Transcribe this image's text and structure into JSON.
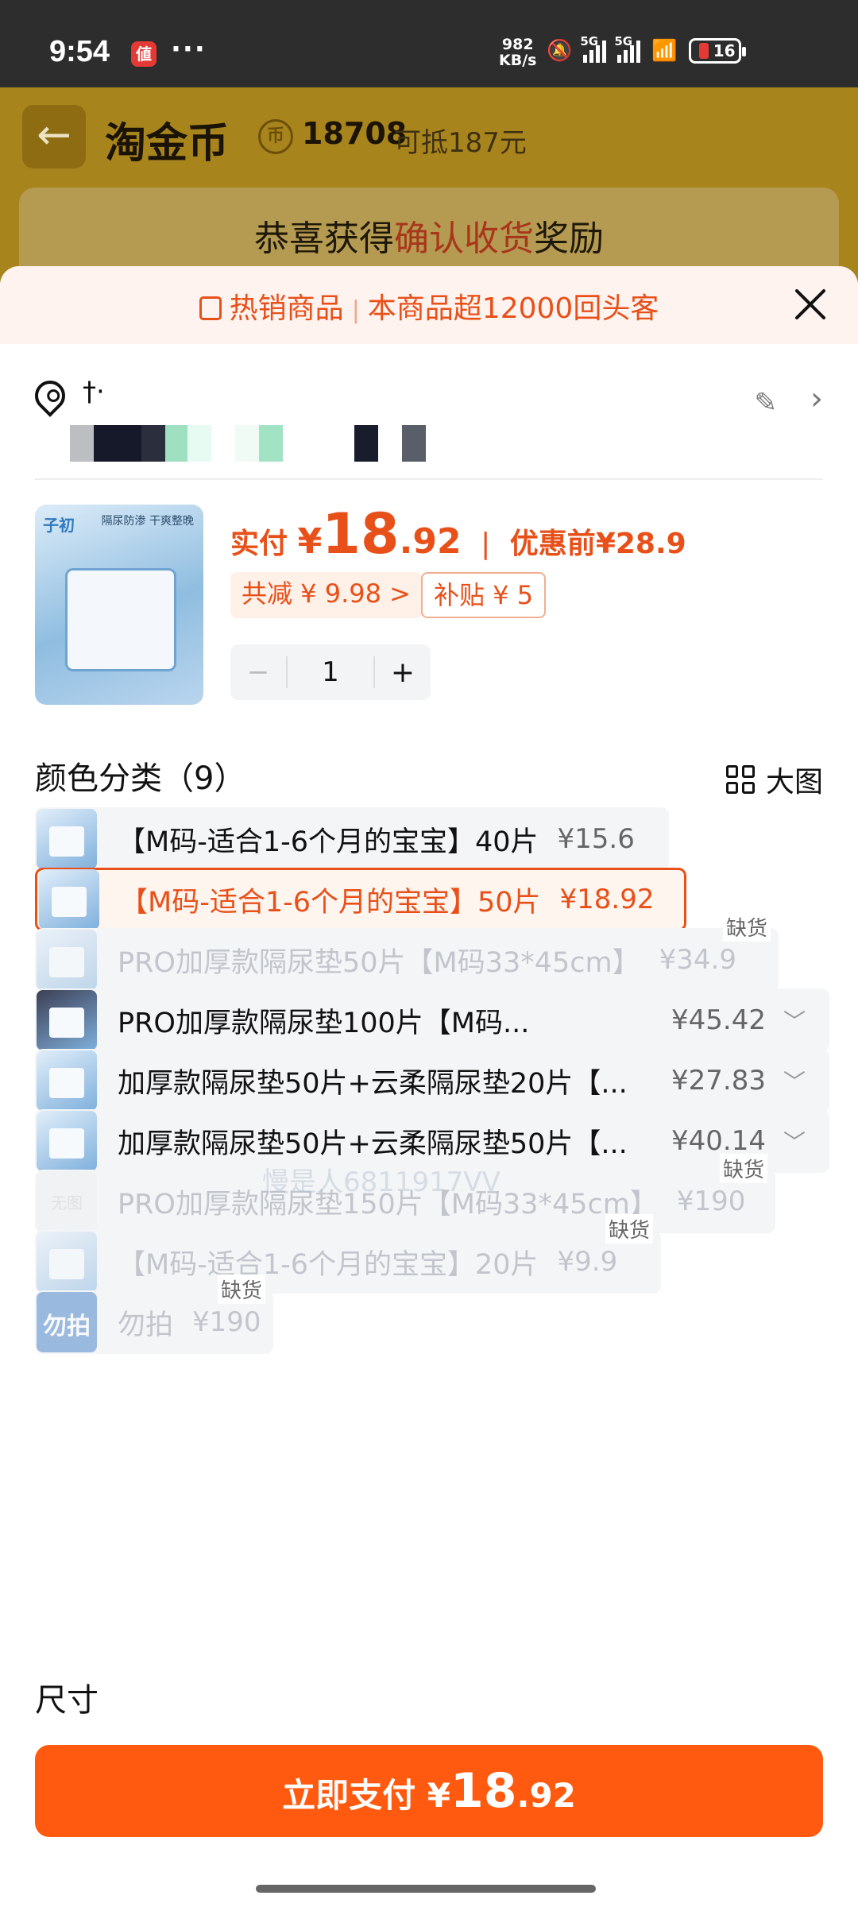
{
  "status_bar": {
    "time": "9:54",
    "app_badge": "値",
    "more": "···",
    "speed_value": "982",
    "speed_unit": "KB/s",
    "net_1": "5G",
    "net_2": "5G",
    "battery": "16"
  },
  "background": {
    "title": "淘金币",
    "coin_symbol": "币",
    "coin_count": "18708",
    "coin_sub": "可抵187元",
    "card_prefix": "恭喜获得",
    "card_highlight": "确认收货",
    "card_suffix": "奖励"
  },
  "sheet": {
    "promo_left": "热销商品",
    "promo_sep": "|",
    "promo_right": "本商品超12000回头客"
  },
  "address": {
    "line1": "†·"
  },
  "product": {
    "brand": "子初",
    "image_tag": "隔尿防渗 干爽整晚",
    "pay_label": "实付",
    "currency": "¥",
    "price_int": "18",
    "price_dec": ".92",
    "before_label": "优惠前",
    "before_price": "¥28.9",
    "discount_chip": "共减 ¥ 9.98 >",
    "subsidy_chip": "补贴 ¥ 5",
    "quantity": "1",
    "minus": "−",
    "plus": "+"
  },
  "color_section": {
    "title": "颜色分类（9）",
    "big_view": "大图",
    "options": [
      {
        "name": "【M码-适合1-6个月的宝宝】40片",
        "price": "¥15.6",
        "state": "normal"
      },
      {
        "name": "【M码-适合1-6个月的宝宝】50片",
        "price": "¥18.92",
        "state": "selected"
      },
      {
        "name": "PRO加厚款隔尿垫50片【M码33*45cm】",
        "price": "¥34.9",
        "state": "disabled",
        "badge": "缺货"
      },
      {
        "name": "PRO加厚款隔尿垫100片【M码...",
        "price": "¥45.42",
        "state": "normal",
        "expand": "﹀"
      },
      {
        "name": "加厚款隔尿垫50片+云柔隔尿垫20片【...",
        "price": "¥27.83",
        "state": "normal",
        "expand": "﹀"
      },
      {
        "name": "加厚款隔尿垫50片+云柔隔尿垫50片【...",
        "price": "¥40.14",
        "state": "normal",
        "expand": "﹀"
      },
      {
        "name": "PRO加厚款隔尿垫150片【M码33*45cm】",
        "price": "¥190",
        "state": "disabled",
        "badge": "缺货",
        "thumb_text": "无图"
      },
      {
        "name": "【M码-适合1-6个月的宝宝】20片",
        "price": "¥9.9",
        "state": "disabled",
        "badge": "缺货"
      },
      {
        "name": "勿拍",
        "price": "¥190",
        "state": "disabled",
        "badge": "缺货",
        "thumb_text": "勿拍"
      }
    ]
  },
  "watermark": "慢是人6811917VV",
  "size_section": {
    "title": "尺寸"
  },
  "pay_button": {
    "label": "立即支付",
    "currency": "¥",
    "price_int": "18",
    "price_dec": ".92"
  },
  "colors": {
    "accent": "#e8501a",
    "pay": "#ff5a0f"
  }
}
